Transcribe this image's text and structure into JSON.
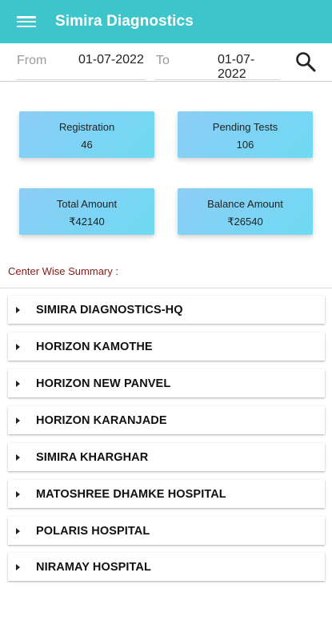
{
  "app": {
    "title": "Simira Diagnostics",
    "accent_color": "#3cc6cc",
    "menu_icon": "hamburger-menu-icon"
  },
  "filter": {
    "from_label": "From",
    "from_date": "01-07-2022",
    "to_label": "To",
    "to_date": "01-07-2022",
    "search_icon": "search-icon"
  },
  "summary": {
    "registration": {
      "label": "Registration",
      "value": "46"
    },
    "pending_tests": {
      "label": "Pending Tests",
      "value": "106"
    },
    "total_amount": {
      "label": "Total Amount",
      "value": "₹42140"
    },
    "balance_amount": {
      "label": "Balance Amount",
      "value": "₹26540"
    }
  },
  "centers": {
    "title": "Center Wise Summary :",
    "items": [
      {
        "name": "SIMIRA DIAGNOSTICS-HQ"
      },
      {
        "name": "HORIZON KAMOTHE"
      },
      {
        "name": "HORIZON NEW PANVEL"
      },
      {
        "name": "HORIZON KARANJADE"
      },
      {
        "name": "SIMIRA KHARGHAR"
      },
      {
        "name": "MATOSHREE DHAMKE HOSPITAL"
      },
      {
        "name": "POLARIS HOSPITAL"
      },
      {
        "name": "NIRAMAY HOSPITAL"
      }
    ]
  }
}
